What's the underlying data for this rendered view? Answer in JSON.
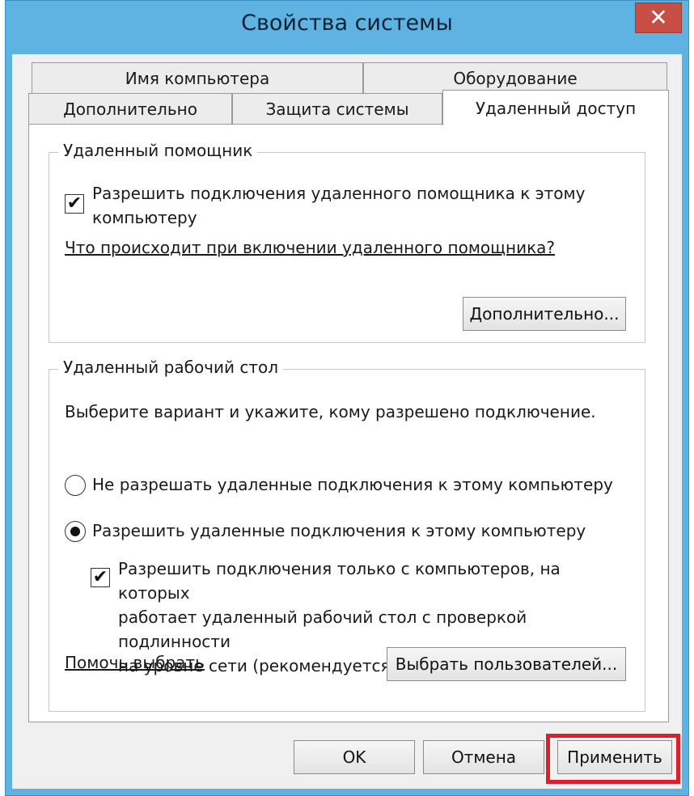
{
  "window": {
    "title": "Свойства системы",
    "close_glyph": "✕"
  },
  "tabs": {
    "row_top": [
      {
        "label": "Имя компьютера"
      },
      {
        "label": "Оборудование"
      }
    ],
    "row_bottom": [
      {
        "label": "Дополнительно"
      },
      {
        "label": "Защита системы"
      },
      {
        "label": "Удаленный доступ",
        "active": true
      }
    ]
  },
  "remote_assistance": {
    "group_label": "Удаленный помощник",
    "checkbox_checked": true,
    "checkbox_label_line1": "Разрешить подключения удаленного помощника к этому",
    "checkbox_label_line2": "компьютеру",
    "help_link": "Что происходит при включении удаленного помощника?",
    "advanced_button": "Дополнительно..."
  },
  "remote_desktop": {
    "group_label": "Удаленный рабочий стол",
    "instruction": "Выберите вариант и укажите, кому разрешено подключение.",
    "options": [
      {
        "label": "Не разрешать удаленные подключения к этому компьютеру",
        "selected": false
      },
      {
        "label": "Разрешить удаленные подключения к этому компьютеру",
        "selected": true
      }
    ],
    "nla_checked": true,
    "nla_label_line1": "Разрешить подключения только с компьютеров, на которых",
    "nla_label_line2": "работает удаленный рабочий стол с проверкой подлинности",
    "nla_label_line3": "на уровне сети (рекомендуется)",
    "help_link": "Помочь выбрать",
    "select_users_button": "Выбрать пользователей..."
  },
  "footer": {
    "ok": "OK",
    "cancel": "Отмена",
    "apply": "Применить"
  },
  "colors": {
    "annotation_red": "#d9202c",
    "title_bar": "#5fb3e3",
    "close_button": "#c74e45"
  }
}
